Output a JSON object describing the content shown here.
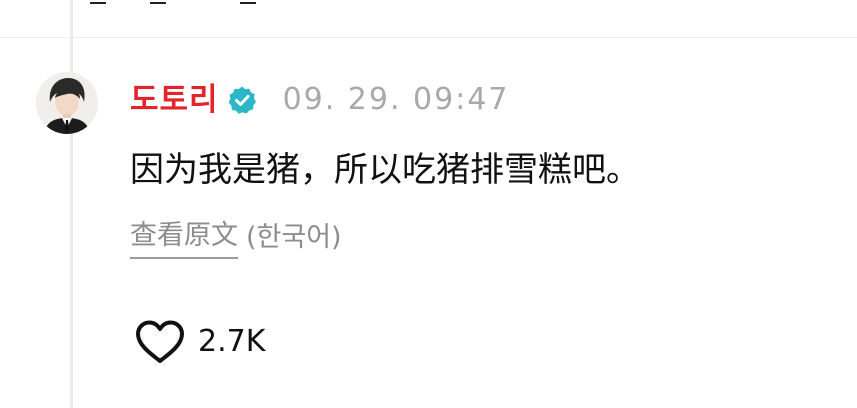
{
  "post": {
    "username": "도토리",
    "timestamp": "09. 29. 09:47",
    "message": "因为我是猪，所以吃猪排雪糕吧。",
    "view_original_label": "查看原文",
    "original_language": "(한국어)",
    "like_count": "2.7K"
  },
  "icons": {
    "verified": "verified-badge-icon",
    "like": "heart-icon",
    "avatar": "profile-avatar"
  },
  "colors": {
    "username": "#e3242b",
    "verified_badge": "#2bb7c6",
    "timestamp": "#a9a9a9",
    "secondary_text": "#8d8d8d"
  }
}
